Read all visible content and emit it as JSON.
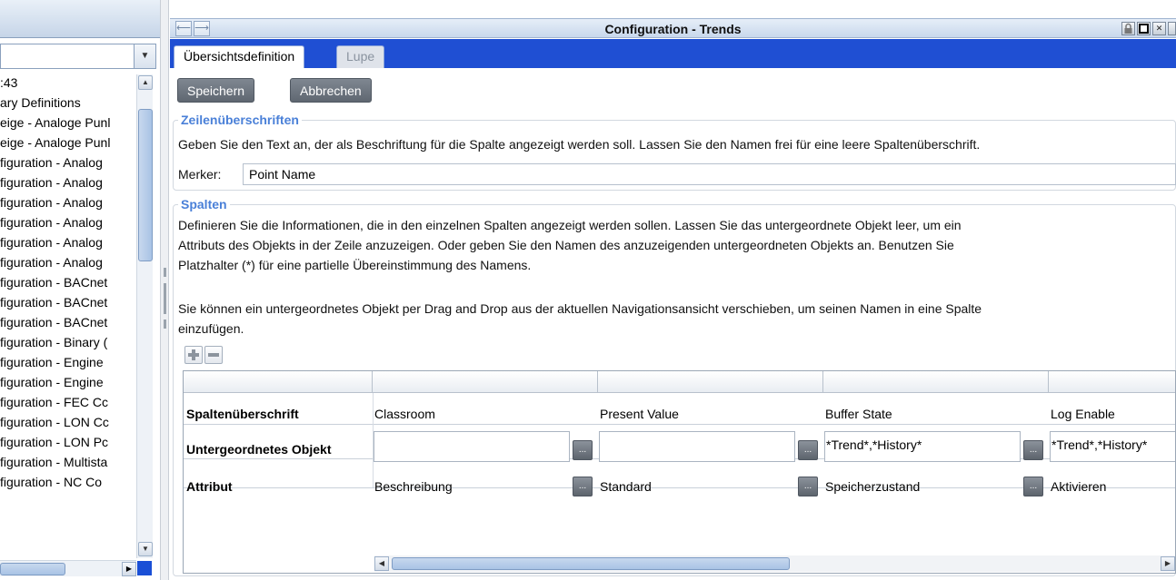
{
  "left_nav": {
    "items": [
      ":43",
      "ary Definitions",
      "eige - Analoge Punl",
      "eige - Analoge Punl",
      "figuration - Analog",
      "figuration - Analog",
      "figuration - Analog",
      "figuration - Analog",
      "figuration - Analog",
      "figuration - Analog",
      "figuration - BACnet",
      "figuration - BACnet",
      "figuration - BACnet",
      "figuration - Binary (",
      "figuration - Engine",
      "figuration - Engine",
      "figuration - FEC Cc",
      "figuration - LON Cc",
      "figuration - LON Pc",
      "figuration - Multista",
      "figuration - NC Co"
    ]
  },
  "window": {
    "title": "Configuration - Trends"
  },
  "tabs": [
    {
      "label": "Übersichtsdefinition",
      "active": true
    },
    {
      "label": "Lupe",
      "active": false
    }
  ],
  "toolbar": {
    "save_label": "Speichern",
    "cancel_label": "Abbrechen"
  },
  "headings_section": {
    "title": "Zeilenüberschriften",
    "description": "Geben Sie den Text an, der als Beschriftung für die Spalte angezeigt werden soll.  Lassen Sie den Namen frei für eine leere Spaltenüberschrift.",
    "merker_label": "Merker:",
    "merker_value": "Point Name"
  },
  "columns_section": {
    "title": "Spalten",
    "description_lines": [
      "Definieren Sie die Informationen, die in den einzelnen Spalten angezeigt werden sollen.  Lassen Sie das untergeordnete Objekt leer, um ein",
      "Attributs des Objekts in der Zeile anzuzeigen.  Oder geben Sie den Namen des anzuzeigenden untergeordneten Objekts an. Benutzen Sie",
      "Platzhalter (*) für eine partielle Übereinstimmung des Namens."
    ],
    "drag_hint_lines": [
      "Sie können ein untergeordnetes Objekt per Drag and Drop aus der aktuellen Navigationsansicht verschieben, um seinen Namen in eine Spalte",
      "einzufügen."
    ]
  },
  "grid": {
    "row_labels": {
      "heading": "Spaltenüberschrift",
      "child_object": "Untergeordnetes Objekt",
      "attribute": "Attribut"
    },
    "columns": [
      {
        "heading": "Classroom",
        "child_object": "",
        "attribute": "Beschreibung"
      },
      {
        "heading": "Present Value",
        "child_object": "",
        "attribute": "Standard"
      },
      {
        "heading": "Buffer State",
        "child_object": "*Trend*,*History*",
        "attribute": "Speicherzustand"
      },
      {
        "heading": "Log Enable",
        "child_object": "*Trend*,*History*",
        "attribute": "Aktivieren"
      }
    ],
    "ellipsis_label": "..."
  },
  "colors": {
    "tab_bar": "#1f4fd3",
    "section_title": "#4a80d8",
    "dark_button": "#6a7079"
  },
  "icons": {
    "add": "plus-icon",
    "remove": "minus-icon",
    "back": "arrow-left-icon",
    "forward": "arrow-right-icon",
    "lock": "lock-icon",
    "restore": "restore-icon",
    "close": "close-icon"
  }
}
